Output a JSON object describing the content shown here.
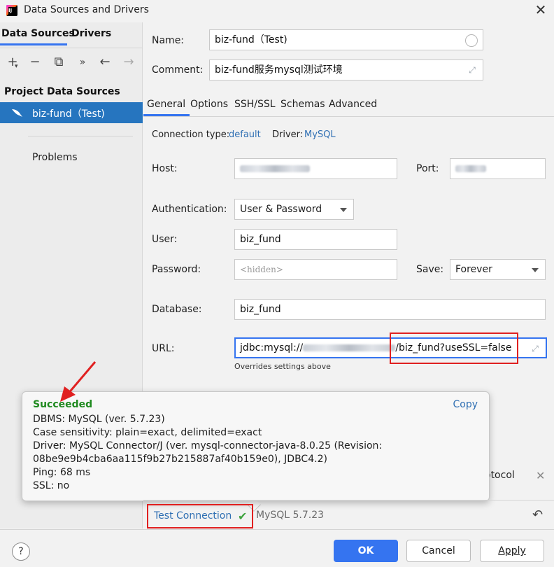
{
  "window": {
    "title": "Data Sources and Drivers",
    "app_icon_text": "IJ"
  },
  "sidebar": {
    "tabs": [
      "Data Sources",
      "Drivers"
    ],
    "section_label": "Project Data Sources",
    "items": [
      {
        "label": "biz-fund（Test)"
      }
    ],
    "problems": "Problems"
  },
  "form": {
    "name_label": "Name:",
    "name_value": "biz-fund（Test)",
    "comment_label": "Comment:",
    "comment_value": "biz-fund服务mysql测试环境",
    "tabs": [
      "General",
      "Options",
      "SSH/SSL",
      "Schemas",
      "Advanced"
    ],
    "connection_type_label": "Connection type:",
    "connection_type_value": "default",
    "driver_label": "Driver:",
    "driver_value": "MySQL",
    "host_label": "Host:",
    "port_label": "Port:",
    "auth_label": "Authentication:",
    "auth_value": "User & Password",
    "user_label": "User:",
    "user_value": "biz_fund",
    "password_label": "Password:",
    "password_placeholder": "<hidden>",
    "save_label": "Save:",
    "save_value": "Forever",
    "database_label": "Database:",
    "database_value": "biz_fund",
    "url_label": "URL:",
    "url_prefix": "jdbc:mysql://",
    "url_suffix": "/biz_fund?useSSL=false",
    "url_note": "Overrides settings above",
    "protocol_fragment": "otocol"
  },
  "popup": {
    "status": "Succeeded",
    "copy": "Copy",
    "lines": [
      "DBMS: MySQL (ver. 5.7.23)",
      "Case sensitivity: plain=exact, delimited=exact",
      "Driver: MySQL Connector/J (ver. mysql-connector-java-8.0.25 (Revision:",
      "08be9e9b4cba6aa115f9b27b215887af40b159e0), JDBC4.2)",
      "Ping: 68 ms",
      "SSL: no"
    ]
  },
  "bottom": {
    "test_connection": "Test Connection",
    "mysql_version": "MySQL 5.7.23"
  },
  "footer": {
    "help": "?",
    "ok": "OK",
    "cancel": "Cancel",
    "apply": "Apply"
  },
  "colors": {
    "accent": "#3574f0",
    "selection": "#2675bf",
    "success": "#1f8a1f",
    "link": "#2f6fb3",
    "highlight": "#e02020"
  }
}
